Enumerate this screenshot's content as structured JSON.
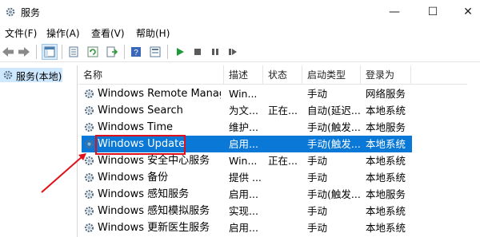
{
  "window": {
    "title": "服务",
    "minimize_glyph": "—",
    "maximize_glyph": "☐",
    "close_glyph": "✕"
  },
  "menu": {
    "items": [
      "文件(F)",
      "操作(A)",
      "查看(V)",
      "帮助(H)"
    ]
  },
  "toolbar": {
    "icons": [
      "back-icon",
      "forward-icon",
      "console-tree-icon",
      "properties-icon",
      "refresh-icon",
      "export-list-icon",
      "help-icon",
      "view-icon",
      "start-service-icon",
      "stop-service-icon",
      "pause-service-icon",
      "restart-service-icon"
    ]
  },
  "tree": {
    "root_label": "服务(本地)"
  },
  "list": {
    "columns": [
      "名称",
      "描述",
      "状态",
      "启动类型",
      "登录为"
    ],
    "rows": [
      {
        "name": "Windows Remote Manag...",
        "desc": "Win...",
        "status": "",
        "start": "手动",
        "logon": "网络服务"
      },
      {
        "name": "Windows Search",
        "desc": "为文...",
        "status": "正在...",
        "start": "自动(延迟...",
        "logon": "本地系统"
      },
      {
        "name": "Windows Time",
        "desc": "维护...",
        "status": "",
        "start": "手动(触发...",
        "logon": "本地服务"
      },
      {
        "name": "Windows Update",
        "desc": "启用...",
        "status": "",
        "start": "手动(触发...",
        "logon": "本地系统"
      },
      {
        "name": "Windows 安全中心服务",
        "desc": "Win...",
        "status": "正在...",
        "start": "手动",
        "logon": "本地系统"
      },
      {
        "name": "Windows 备份",
        "desc": "提供 ...",
        "status": "",
        "start": "手动",
        "logon": "本地系统"
      },
      {
        "name": "Windows 感知服务",
        "desc": "启用...",
        "status": "",
        "start": "手动(触发...",
        "logon": "本地服务"
      },
      {
        "name": "Windows 感知模拟服务",
        "desc": "实现...",
        "status": "",
        "start": "手动",
        "logon": "本地系统"
      },
      {
        "name": "Windows 更新医生服务",
        "desc": "启用...",
        "status": "",
        "start": "手动",
        "logon": "本地系统"
      }
    ],
    "selected_index": 3
  },
  "colors": {
    "selection": "#0a78d7",
    "annotation_red": "#e0101a",
    "tree_selected": "#cde8ff"
  }
}
